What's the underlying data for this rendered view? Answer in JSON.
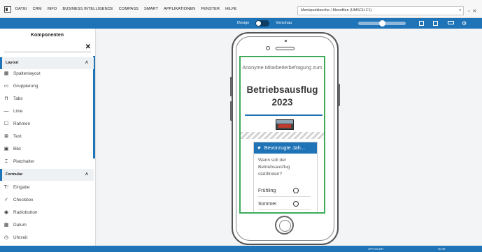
{
  "menu": [
    "DATEI",
    "CRM",
    "INFO",
    "BUSINESS INTELLIGENCE",
    "COMPASS",
    "SMART",
    "APPLIKATIONEN",
    "FENSTER",
    "HILFE"
  ],
  "search": {
    "value": "Menüpunktsuche / Mesofilen (UMSCH F1)"
  },
  "window_controls": "▫ ✕",
  "toolbar": {
    "design_label": "Design",
    "preview_label": "Vorschau"
  },
  "sidebar": {
    "title": "Komponenten",
    "sections": [
      {
        "label": "Layout",
        "items": [
          {
            "icon": "columns-icon",
            "glyph": "▦",
            "label": "Spaltenlayout"
          },
          {
            "icon": "group-icon",
            "glyph": "▭",
            "label": "Gruppierung"
          },
          {
            "icon": "tabs-icon",
            "glyph": "⊓",
            "label": "Tabs"
          },
          {
            "icon": "line-icon",
            "glyph": "—",
            "label": "Linie"
          },
          {
            "icon": "frame-icon",
            "glyph": "☐",
            "label": "Rahmen"
          },
          {
            "icon": "text-icon",
            "glyph": "⊠",
            "label": "Text"
          },
          {
            "icon": "image-icon",
            "glyph": "▣",
            "label": "Bild"
          },
          {
            "icon": "placeholder-icon",
            "glyph": "⌶",
            "label": "Platzhalter"
          }
        ]
      },
      {
        "label": "Formular",
        "items": [
          {
            "icon": "input-icon",
            "glyph": "T⁝",
            "label": "Eingabe"
          },
          {
            "icon": "checkbox-icon",
            "glyph": "✓",
            "label": "Checkbox"
          },
          {
            "icon": "radiobutton-icon",
            "glyph": "◉",
            "label": "Radiobutton"
          },
          {
            "icon": "date-icon",
            "glyph": "▦",
            "label": "Datum"
          },
          {
            "icon": "clock-icon",
            "glyph": "◷",
            "label": "Uhrzeit"
          }
        ]
      }
    ]
  },
  "preview": {
    "subtitle": "Anonyme Mitarbeiterbefragung zum",
    "title": "Betriebsausflug",
    "year": "2023",
    "card": {
      "header": "Bevorzugte Jah...",
      "question": "Wann soll der Betriebsausflug stattfinden?",
      "options": [
        "Frühling",
        "Sommer"
      ]
    }
  },
  "statusbar": {
    "user": "SPOOLER",
    "num": "NUM"
  }
}
